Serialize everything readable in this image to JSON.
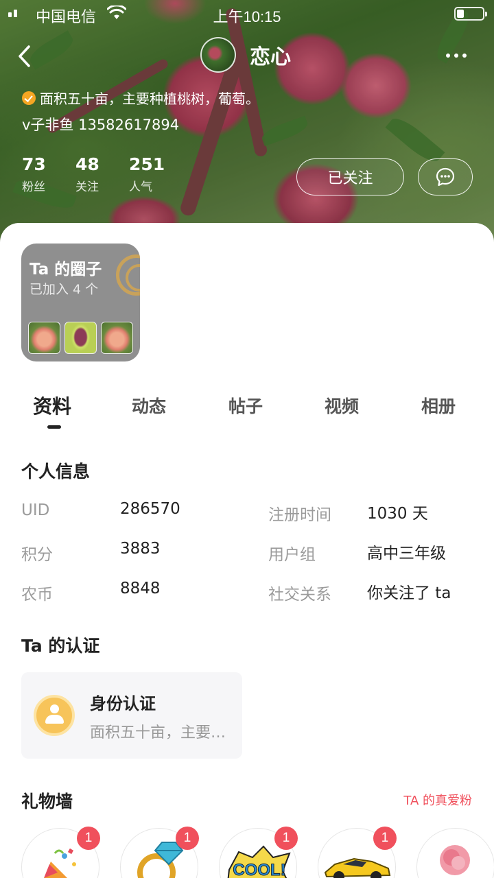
{
  "status_bar": {
    "carrier": "中国电信",
    "time": "上午10:15"
  },
  "profile": {
    "nickname": "恋心",
    "bio": "面积五十亩，主要种植桃树，葡萄。",
    "contact": "v子非鱼 13582617894",
    "stats": [
      {
        "value": "73",
        "label": "粉丝"
      },
      {
        "value": "48",
        "label": "关注"
      },
      {
        "value": "251",
        "label": "人气"
      }
    ],
    "follow_label": "已关注"
  },
  "circle": {
    "title": "Ta 的圈子",
    "subtitle": "已加入 4 个"
  },
  "tabs": [
    "资料",
    "动态",
    "帖子",
    "视频",
    "相册"
  ],
  "personal_info": {
    "title": "个人信息",
    "left": [
      {
        "label": "UID",
        "value": "286570"
      },
      {
        "label": "积分",
        "value": "3883"
      },
      {
        "label": "农币",
        "value": "8848"
      }
    ],
    "right": [
      {
        "label": "注册时间",
        "value": "1030 天"
      },
      {
        "label": "用户组",
        "value": "高中三年级"
      },
      {
        "label": "社交关系",
        "value": "你关注了 ta"
      }
    ]
  },
  "certification": {
    "title": "Ta 的认证",
    "card_title": "身份认证",
    "card_desc": "面积五十亩，主要种植桃树，葡萄。"
  },
  "gift_wall": {
    "title": "礼物墙",
    "fans_link": "TA 的真爱粉",
    "gifts": [
      {
        "icon": "party-popper-icon",
        "count": "1"
      },
      {
        "icon": "diamond-ring-icon",
        "count": "1"
      },
      {
        "icon": "cool-sticker-icon",
        "count": "1"
      },
      {
        "icon": "sports-car-icon",
        "count": "1"
      },
      {
        "icon": "rose-icon",
        "count": ""
      }
    ]
  },
  "colors": {
    "accent": "#f0505c",
    "badge": "#f5a623"
  }
}
